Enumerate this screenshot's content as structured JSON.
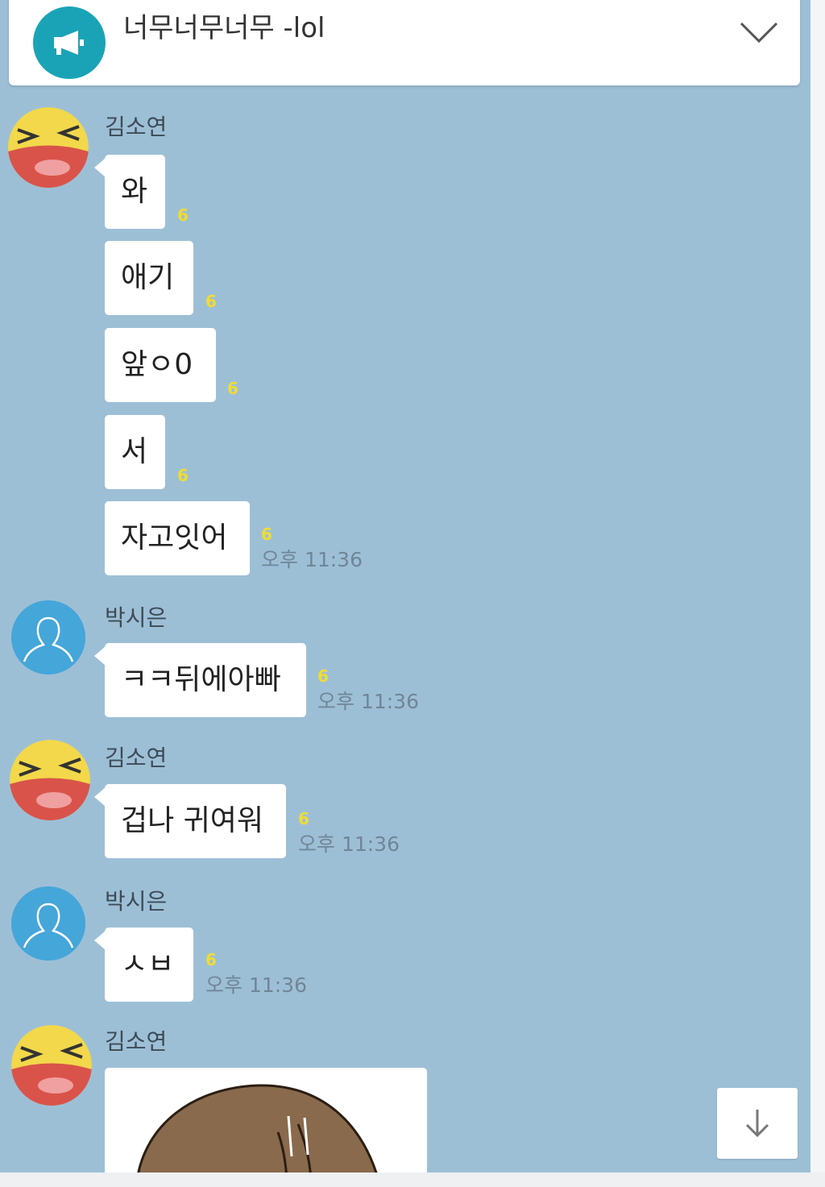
{
  "notice": {
    "title": "너무너무너무 -lol",
    "icon": "megaphone-icon",
    "accent": "#1aa3b6",
    "expand_icon": "chevron-down-icon"
  },
  "chat_background": "#9dbfd6",
  "messages": [
    {
      "sender": "김소연",
      "bubbles": [
        {
          "text": "와",
          "unread": "6"
        },
        {
          "text": "애기",
          "unread": "6"
        },
        {
          "text": "앞ㅇ0",
          "unread": "6"
        },
        {
          "text": "서",
          "unread": "6"
        },
        {
          "text": "자고잇어",
          "unread": "6",
          "time": "오후 11:36"
        }
      ]
    },
    {
      "sender": "박시은",
      "bubbles": [
        {
          "text": "ㅋㅋ뒤에아빠",
          "unread": "6",
          "time": "오후 11:36"
        }
      ]
    },
    {
      "sender": "김소연",
      "bubbles": [
        {
          "text": "겁나 귀여워",
          "unread": "6",
          "time": "오후 11:36"
        }
      ]
    },
    {
      "sender": "박시은",
      "bubbles": [
        {
          "text": "ㅅㅂ",
          "unread": "6",
          "time": "오후 11:36"
        }
      ]
    },
    {
      "sender": "김소연",
      "bubbles": [
        {
          "image": "cartoon-image"
        }
      ]
    }
  ],
  "scroll_down_icon": "arrow-down-icon"
}
